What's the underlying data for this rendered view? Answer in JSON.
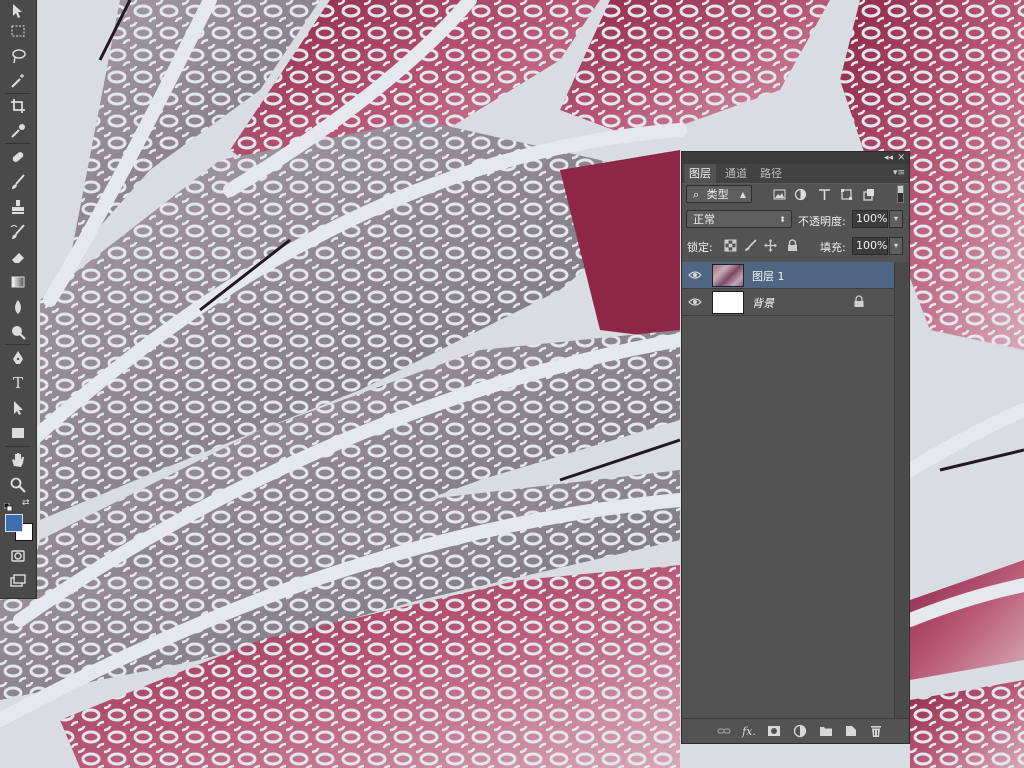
{
  "toolbox": {
    "tools": [
      "move-tool",
      "marquee-tool",
      "lasso-tool",
      "magic-wand-tool",
      "crop-tool",
      "eyedropper-tool",
      "spot-healing-tool",
      "brush-tool",
      "clone-stamp-tool",
      "history-brush-tool",
      "eraser-tool",
      "gradient-tool",
      "blur-tool",
      "dodge-tool",
      "pen-tool",
      "type-tool",
      "path-selection-tool",
      "rectangle-tool",
      "hand-tool",
      "zoom-tool",
      "quick-mask-tool",
      "screen-mode-tool"
    ],
    "type_label": "T",
    "foreground_color": "#3d6fb0",
    "background_color": "#ffffff"
  },
  "panel": {
    "collapse_label": "◂◂",
    "close_label": "✕",
    "tabs": [
      {
        "label": "图层",
        "active": true
      },
      {
        "label": "通道",
        "active": false
      },
      {
        "label": "路径",
        "active": false
      }
    ],
    "filter": {
      "search_glyph": "⌕",
      "value": "类型"
    },
    "blend_mode": "正常",
    "opacity_label": "不透明度:",
    "opacity_value": "100%",
    "lock_label": "锁定:",
    "fill_label": "填充:",
    "fill_value": "100%",
    "layers": [
      {
        "name": "图层 1",
        "selected": true,
        "visible": true,
        "locked": false
      },
      {
        "name": "背景",
        "selected": false,
        "visible": true,
        "locked": true
      }
    ],
    "bottom_icons": [
      "link-layers-icon",
      "fx-icon",
      "layer-mask-icon",
      "adjustment-layer-icon",
      "new-group-icon",
      "new-layer-icon",
      "delete-layer-icon"
    ],
    "fx_label": "fx."
  },
  "colors": {
    "panel_bg": "#535353",
    "selected_layer": "#4f6683",
    "canvas_white": "#d9dde2",
    "canvas_rose": "#8e2747"
  }
}
